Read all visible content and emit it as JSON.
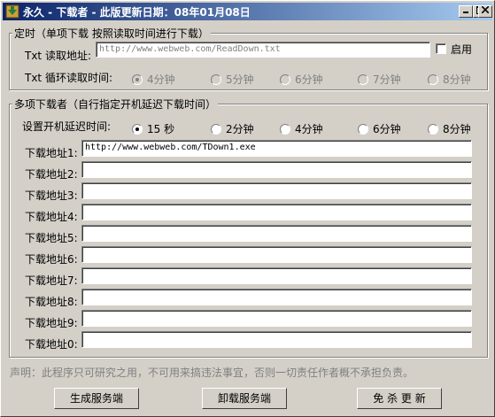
{
  "window": {
    "title": "永久 - 下载者 - 此版更新日期：08年01月08日"
  },
  "colors": {
    "titlebar_start": "#0a246a",
    "titlebar_end": "#a6caf0",
    "face": "#d4d0c8"
  },
  "timer_group": {
    "label": "定时（单项下载  按照读取时间进行下载）",
    "txt_address_label": "Txt 读取地址:",
    "txt_address_value": "http://www.webweb.com/ReadDown.txt",
    "enable_label": "启用",
    "enable_checked": false,
    "interval_label": "Txt 循环读取时间:",
    "intervals": [
      "4分钟",
      "5分钟",
      "6分钟",
      "7分钟",
      "8分钟"
    ],
    "selected_interval": "4分钟"
  },
  "multi_group": {
    "label": "多项下载者（自行指定开机延迟下载时间）",
    "delay_label": "设置开机延迟时间:",
    "delays": [
      "15 秒",
      "2分钟",
      "4分钟",
      "6分钟",
      "8分钟"
    ],
    "selected_delay": "15 秒",
    "downloads": [
      {
        "label": "下载地址1:",
        "value": "http://www.webweb.com/TDown1.exe"
      },
      {
        "label": "下载地址2:",
        "value": ""
      },
      {
        "label": "下载地址3:",
        "value": ""
      },
      {
        "label": "下载地址4:",
        "value": ""
      },
      {
        "label": "下载地址5:",
        "value": ""
      },
      {
        "label": "下载地址6:",
        "value": ""
      },
      {
        "label": "下载地址7:",
        "value": ""
      },
      {
        "label": "下载地址8:",
        "value": ""
      },
      {
        "label": "下载地址9:",
        "value": ""
      },
      {
        "label": "下载地址0:",
        "value": ""
      }
    ]
  },
  "disclaimer": "声明：此程序只可研究之用，不可用来搞违法事宜，否则一切责任作者概不承担负责。",
  "buttons": {
    "generate": "生成服务端",
    "uninstall": "卸载服务端",
    "free_update": "免 杀 更 新"
  }
}
